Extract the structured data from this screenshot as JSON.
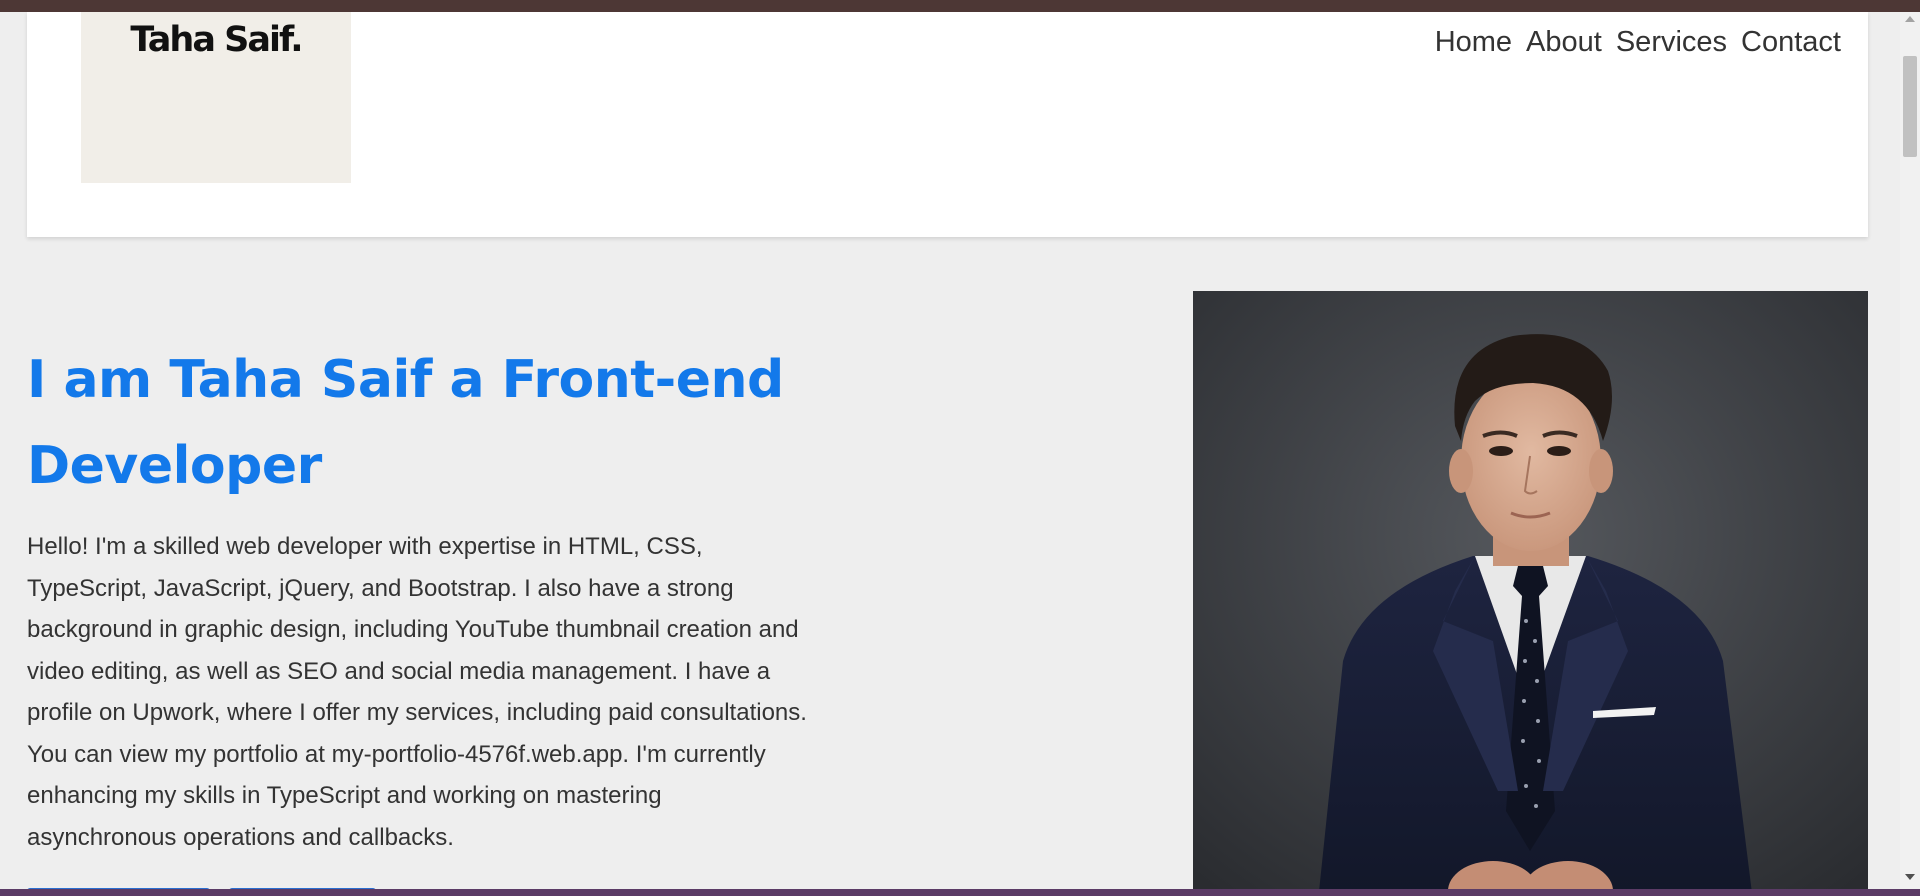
{
  "header": {
    "logo_text": "Taha Saif.",
    "nav": [
      {
        "label": "Home"
      },
      {
        "label": "About"
      },
      {
        "label": "Services"
      },
      {
        "label": "Contact"
      }
    ]
  },
  "hero": {
    "title": "I am Taha Saif a Front-end Developer",
    "paragraph": "Hello! I'm a skilled web developer with expertise in HTML, CSS, TypeScript, JavaScript, jQuery, and Bootstrap. I also have a strong background in graphic design, including YouTube thumbnail creation and video editing, as well as SEO and social media management. I have a profile on Upwork, where I offer my services, including paid consultations. You can view my portfolio at my-portfolio-4576f.web.app. I'm currently enhancing my skills in TypeScript and working on mastering asynchronous operations and callbacks."
  },
  "colors": {
    "accent": "#1379ea",
    "background": "#eeeeee",
    "text": "#333333",
    "top_border": "#4d3735",
    "bottom_border": "#5b3b66"
  }
}
